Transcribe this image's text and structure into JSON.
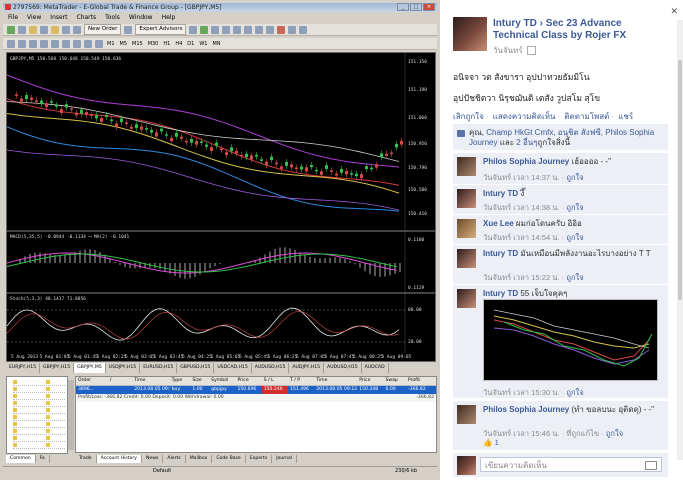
{
  "metatrader": {
    "title": "2797569: MetaTrader - E-Global Trade & Finance Group - [GBPJPY,M5]",
    "menu": [
      "File",
      "View",
      "Insert",
      "Charts",
      "Tools",
      "Window",
      "Help"
    ],
    "toolbar": {
      "new_order": "New Order",
      "expert_advisors": "Expert Advisors",
      "timeframes": [
        "M1",
        "M5",
        "M15",
        "M30",
        "H1",
        "H4",
        "D1",
        "W1",
        "MN"
      ]
    },
    "chart": {
      "header": "GBPJPY,M5  150.568 150.648 150.549 150.636",
      "price_labels": [
        "151.350",
        "151.190",
        "151.060",
        "150.950",
        "150.790",
        "150.580",
        "150.410"
      ],
      "macd_label": "MACD(5,35,5) -0.0944 -0.1134  ⟶ MA(2) -0.1041",
      "macd_levels": [
        "0.1180",
        "0.1129"
      ],
      "stoch_label": "Stoch(5,3,3) 48.1417 71.8856",
      "stoch_levels": [
        "80.00",
        "20.00"
      ],
      "time_labels": [
        "5 Aug 2013",
        "5 Aug 01:05",
        "5 Aug 01:45",
        "5 Aug 02:25",
        "5 Aug 03:05",
        "5 Aug 03:45",
        "5 Aug 04:25",
        "5 Aug 05:05",
        "5 Aug 05:45",
        "5 Aug 06:25",
        "5 Aug 07:05",
        "5 Aug 07:45",
        "5 Aug 08:25",
        "5 Aug 09:05"
      ]
    },
    "chart_tabs": [
      "EURJPY,H15",
      "GBPJPY,H15",
      "GBPJPY,M5",
      "USDJPY,H15",
      "EURUSD,H15",
      "GBPUSD,H15",
      "USDCAD,H15",
      "AUDUSD,H15",
      "AUDJPY,H15",
      "AUDUSD,H15",
      "AUDCAD"
    ],
    "terminal": {
      "columns": [
        "Order",
        "/",
        "Time",
        "Type",
        "Size",
        "Symbol",
        "Price",
        "S / L",
        "T / P",
        "Time",
        "Price",
        "Swap",
        "Profit"
      ],
      "row": [
        "3896...",
        "",
        "2013.08.05 09:05",
        "buy",
        "1.00",
        "gbpjpy",
        "150.696",
        "150.246",
        "151.496",
        "2013.08.05 09:12",
        "150.348",
        "0.00",
        "-366.82"
      ],
      "summary": "Profit/Loss: -366.82  Credit: 0.00  Deposit: 0.00  Withdrawal: 0.00",
      "summary_value": "-366.82",
      "tabs": [
        "Trade",
        "Account History",
        "News",
        "Alerts",
        "Mailbox",
        "Code Base",
        "Experts",
        "Journal"
      ]
    },
    "navigator_tabs": [
      "Common",
      "Fa"
    ],
    "status": {
      "default": "Default",
      "traffic": "230/6 kb"
    }
  },
  "facebook": {
    "author": "Intury TD",
    "album": "Sec 23 Advance Technical Class by Rojer FX",
    "date": "วันจันทร์",
    "post_line1": "อนิจจา วต สังขารา อุปปาทวยธัมมิโน",
    "post_line2": "อุปปัชชิตวา นิรุชฌันติ เตสัง วูปสโม สุโข",
    "actions": [
      "เลิกถูกใจ",
      "แสดงความคิดเห็น",
      "ติดตามโพสต์",
      "แชร์"
    ],
    "likes_prefix": "คุณ, ",
    "likes_names": "Champ HkGt Cmfx, อนุชิต สังฟซี, Philos Sophia Journey",
    "likes_suffix": " และ ",
    "likes_more": "2 อื่นๆ",
    "likes_tail": "ถูกใจสิ่งนี้",
    "comments": [
      {
        "name": "Philos Sophia Journey",
        "text": "เฮ้ออออ - -\"",
        "time": "วันจันทร์ เวลา 14:37 น.",
        "like": "ถูกใจ"
      },
      {
        "name": "Intury TD",
        "text": "งึ๊",
        "time": "วันจันทร์ เวลา 14:38 น.",
        "like": "ถูกใจ"
      },
      {
        "name": "Xue Lee",
        "text": "ผมก่อโดนครับ อิอิอ",
        "time": "วันจันทร์ เวลา 14:54 น.",
        "like": "ถูกใจ"
      },
      {
        "name": "Intury TD",
        "text": "มันเหมือนมีพลังงานอะไรบางอย่าง T T",
        "time": "วันจันทร์ เวลา 15:22 น.",
        "like": "ถูกใจ"
      },
      {
        "name": "Intury TD",
        "text": "55 เจ็บใจคุคๆ",
        "time": "วันจันทร์ เวลา 15:30 น.",
        "like": "ถูกใจ"
      },
      {
        "name": "Philos Sophia Journey",
        "text": "(ทำ ขอลบนะ อุติดดุ) - -\"",
        "time": "วันจันทร์ เวลา 15:46 น.",
        "location": "ที่ถูกแก้ไข",
        "like": "ถูกใจ",
        "like_count": "1"
      }
    ],
    "input_placeholder": "เขียนความคิดเห็น"
  }
}
